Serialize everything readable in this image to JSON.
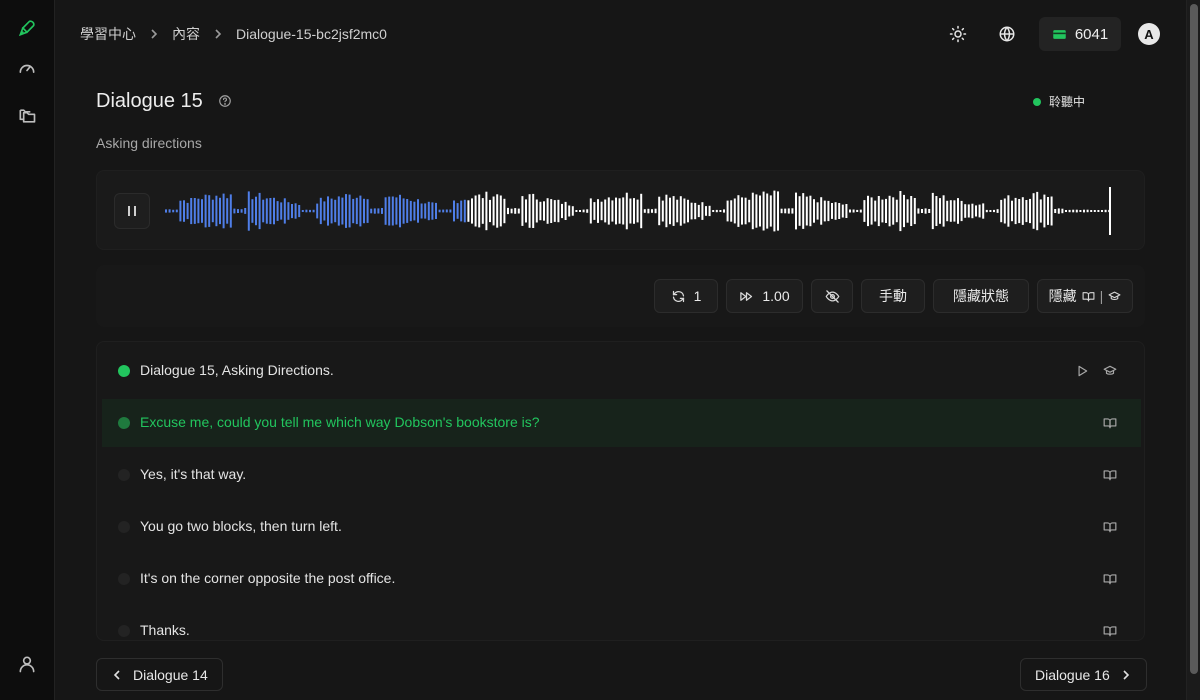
{
  "colors": {
    "accent": "#22c55e",
    "played_wave": "#4f7ee8",
    "unplayed_wave": "#ffffff",
    "background": "#161616"
  },
  "sidebar": {
    "items": [
      {
        "name": "mic-icon",
        "active": true
      },
      {
        "name": "gauge-icon",
        "active": false
      },
      {
        "name": "folders-icon",
        "active": false
      }
    ],
    "bottom": {
      "name": "user-icon"
    }
  },
  "breadcrumb": [
    "學習中心",
    "內容",
    "Dialogue-15-bc2jsf2mc0"
  ],
  "header": {
    "theme_icon": "sun-icon",
    "language_icon": "globe-icon",
    "credits": "6041",
    "avatar_initial": "A"
  },
  "page": {
    "title": "Dialogue 15",
    "subtitle": "Asking directions",
    "status": "聆聽中"
  },
  "player": {
    "state": "playing",
    "progress": 0.32
  },
  "controls": {
    "loop_count": "1",
    "speed": "1.00",
    "mode": "手動",
    "hide_status": "隱藏狀態",
    "hide_label": "隱藏",
    "hide_separator": "|"
  },
  "transcript": [
    {
      "text": "Dialogue 15, Asking Directions.",
      "state": "done"
    },
    {
      "text": "Excuse me, could you tell me which way Dobson's bookstore is?",
      "state": "current"
    },
    {
      "text": "Yes, it's that way.",
      "state": "pending"
    },
    {
      "text": "You go two blocks, then turn left.",
      "state": "pending"
    },
    {
      "text": "It's on the corner opposite the post office.",
      "state": "pending"
    },
    {
      "text": "Thanks.",
      "state": "pending"
    }
  ],
  "navigation": {
    "prev": "Dialogue 14",
    "next": "Dialogue 16"
  }
}
